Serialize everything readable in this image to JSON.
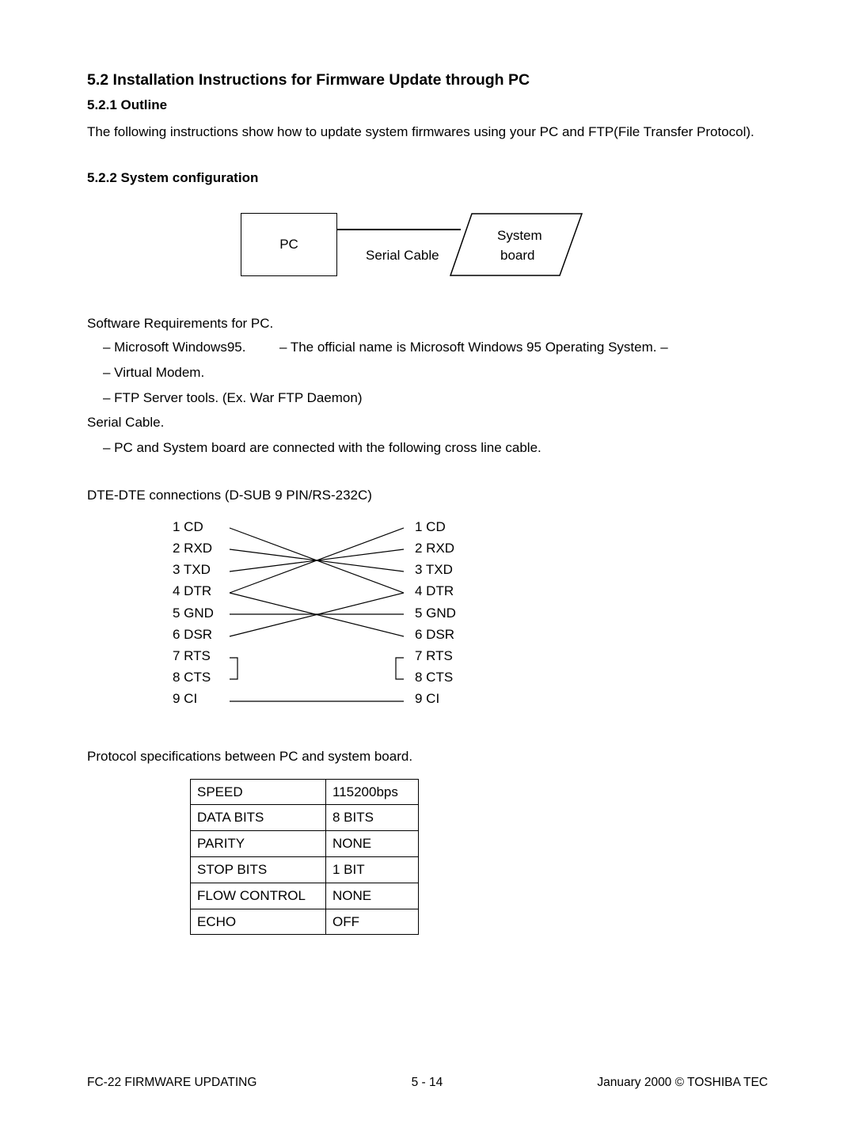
{
  "h1": "5.2 Installation Instructions for Firmware Update through PC",
  "h2a": "5.2.1 Outline",
  "para1": "The following instructions show how to update system firmwares using your PC and FTP(File Transfer Protocol).",
  "h2b": "5.2.2 System configuration",
  "diag_pc": "PC",
  "diag_serial": "Serial Cable",
  "diag_sys1": "System",
  "diag_sys2": "board",
  "swreq_head": "Software Requirements for PC.",
  "swreq_items": [
    "– Microsoft Windows95.         – The official name is Microsoft Windows 95 Operating System. –",
    "– Virtual Modem.",
    "– FTP Server tools. (Ex. War FTP Daemon)"
  ],
  "serial_head": "Serial Cable.",
  "serial_item": "– PC and System board are connected with the following cross line cable.",
  "dte_title": "DTE-DTE connections (D-SUB 9 PIN/RS-232C)",
  "pins": [
    "1 CD",
    "2 RXD",
    "3 TXD",
    "4 DTR",
    "5 GND",
    "6 DSR",
    "7 RTS",
    "8 CTS",
    "9 CI"
  ],
  "proto_title": "Protocol specifications between PC and system board.",
  "table": [
    {
      "k": "SPEED",
      "v": "115200bps"
    },
    {
      "k": "DATA BITS",
      "v": "8 BITS"
    },
    {
      "k": "PARITY",
      "v": "NONE"
    },
    {
      "k": "STOP BITS",
      "v": "1 BIT"
    },
    {
      "k": "FLOW CONTROL",
      "v": "NONE"
    },
    {
      "k": "ECHO",
      "v": "OFF"
    }
  ],
  "footer_left": "FC-22  FIRMWARE UPDATING",
  "footer_mid": "5 - 14",
  "footer_right": "January 2000  ©  TOSHIBA TEC",
  "chart_data": {
    "type": "diagram",
    "pinout": {
      "left_labels": [
        "1 CD",
        "2 RXD",
        "3 TXD",
        "4 DTR",
        "5 GND",
        "6 DSR",
        "7 RTS",
        "8 CTS",
        "9 CI"
      ],
      "right_labels": [
        "1 CD",
        "2 RXD",
        "3 TXD",
        "4 DTR",
        "5 GND",
        "6 DSR",
        "7 RTS",
        "8 CTS",
        "9 CI"
      ],
      "connections": [
        {
          "from": "1 CD",
          "to": "4 DTR"
        },
        {
          "from": "2 RXD",
          "to": "3 TXD"
        },
        {
          "from": "3 TXD",
          "to": "2 RXD"
        },
        {
          "from": "4 DTR",
          "to": "1 CD"
        },
        {
          "from": "4 DTR",
          "to": "6 DSR"
        },
        {
          "from": "5 GND",
          "to": "5 GND"
        },
        {
          "from": "6 DSR",
          "to": "4 DTR"
        },
        {
          "from": "7 RTS",
          "to": "8 CTS",
          "bridge": "local-left"
        },
        {
          "from": "8 CTS",
          "to": "7 RTS",
          "bridge": "local-right"
        },
        {
          "from": "9 CI",
          "to": "9 CI"
        }
      ]
    },
    "protocol_table": [
      {
        "k": "SPEED",
        "v": "115200bps"
      },
      {
        "k": "DATA BITS",
        "v": "8 BITS"
      },
      {
        "k": "PARITY",
        "v": "NONE"
      },
      {
        "k": "STOP BITS",
        "v": "1 BIT"
      },
      {
        "k": "FLOW CONTROL",
        "v": "NONE"
      },
      {
        "k": "ECHO",
        "v": "OFF"
      }
    ]
  }
}
